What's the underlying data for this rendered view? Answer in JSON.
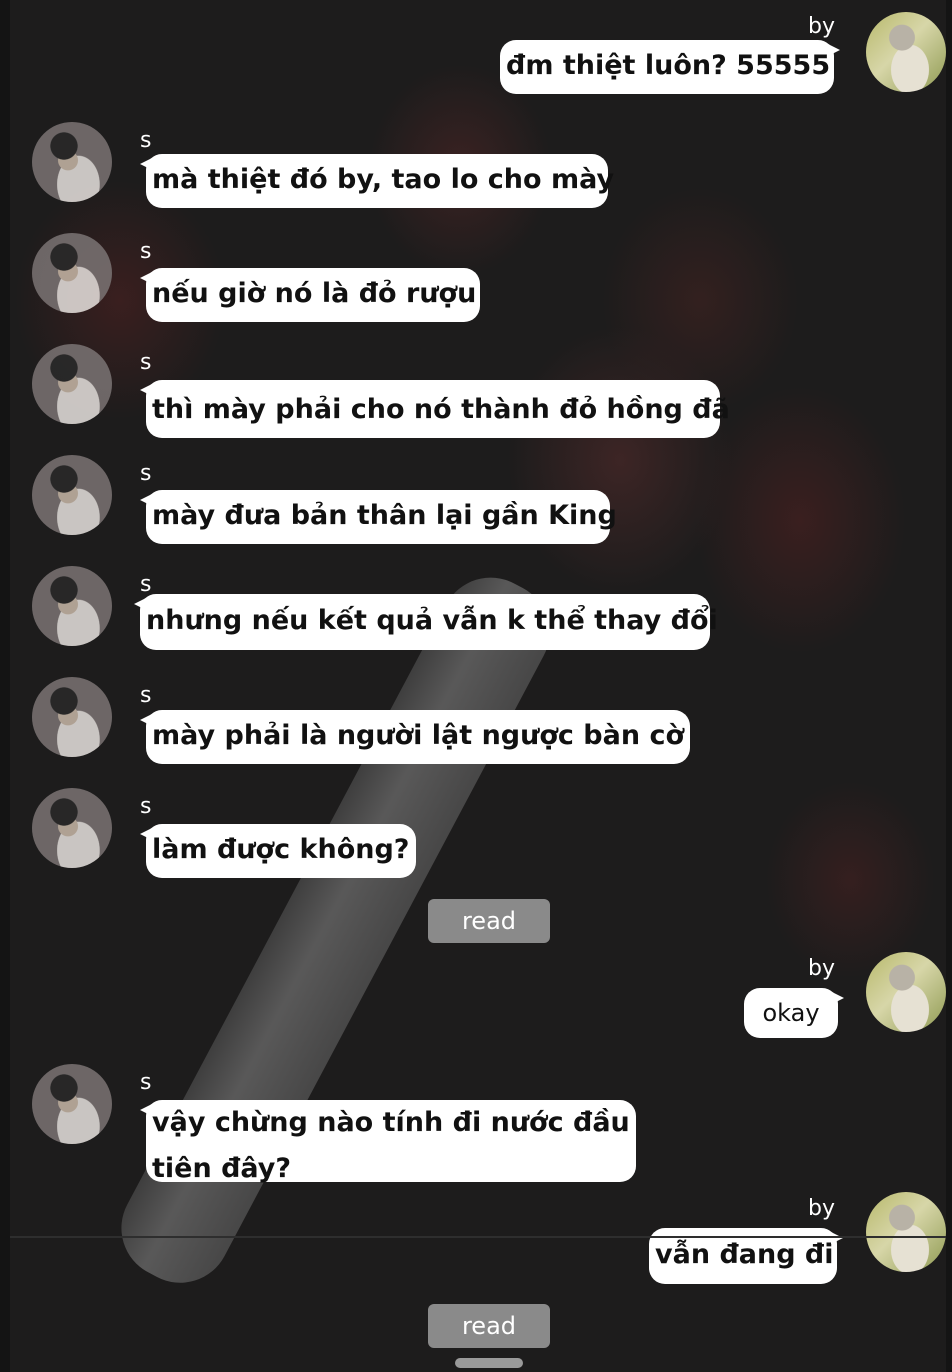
{
  "conversation": {
    "messages": [
      {
        "sender": "by",
        "text": "đm thiệt luôn? 55555"
      },
      {
        "sender": "s",
        "text": "mà thiệt đó by, tao lo cho mày"
      },
      {
        "sender": "s",
        "text": "nếu giờ nó là đỏ rượu"
      },
      {
        "sender": "s",
        "text": "thì mày phải cho nó thành đỏ hồng đã"
      },
      {
        "sender": "s",
        "text": "mày đưa bản thân lại gần King"
      },
      {
        "sender": "s",
        "text": "nhưng nếu kết quả vẫn k thể thay đổi"
      },
      {
        "sender": "s",
        "text": "mày phải là người lật ngược bàn cờ"
      },
      {
        "sender": "s",
        "text": "làm được không?"
      },
      {
        "sender": "by",
        "text": "okay"
      },
      {
        "sender": "s",
        "text": "vậy chừng nào tính đi nước đầu tiên đây?"
      },
      {
        "sender": "by",
        "text": "vẫn đang đi"
      }
    ],
    "read_labels": [
      "read",
      "read"
    ]
  },
  "colors": {
    "bubble": "#ffffff",
    "read_button": "#8a8a8a",
    "background": "#1d1c1c"
  },
  "icons": {
    "avatar_s": "avatar-s-icon",
    "avatar_by": "avatar-by-icon"
  }
}
